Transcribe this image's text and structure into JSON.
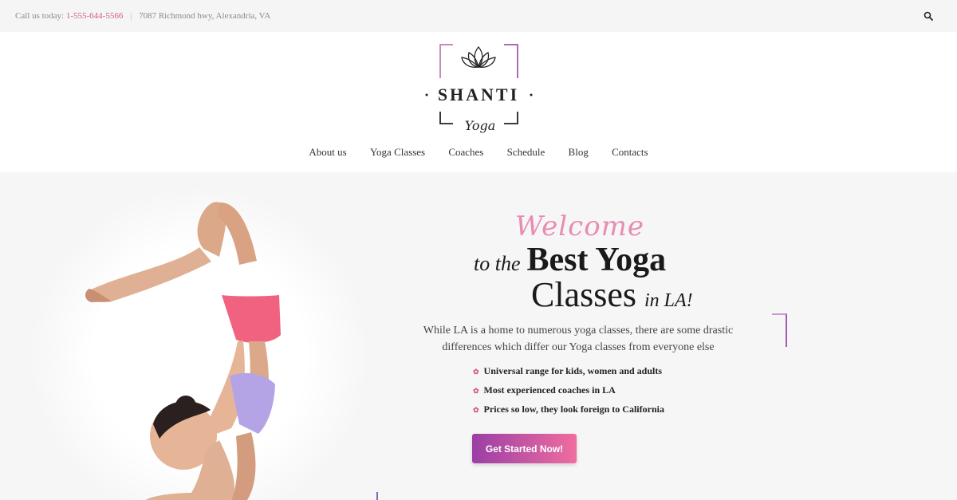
{
  "topbar": {
    "call_label": "Call us today:",
    "phone": "1-555-644-5566",
    "separator": "|",
    "address": "7087 Richmond hwy, Alexandria, VA",
    "search_icon": "search-icon"
  },
  "logo": {
    "brand": "SHANTI",
    "script": "Yoga",
    "icon": "lotus-icon"
  },
  "nav": {
    "items": [
      "About us",
      "Yoga Classes",
      "Coaches",
      "Schedule",
      "Blog",
      "Contacts"
    ]
  },
  "hero": {
    "welcome": "Welcome",
    "title_prefix": "to the",
    "title_main": "Best Yoga",
    "title_line2": "Classes",
    "title_suffix": "in LA!",
    "description": "While LA is a home to numerous yoga classes, there are some drastic differences which differ our Yoga classes from everyone else",
    "bullets": [
      "Universal range for kids, women and adults",
      "Most experienced coaches in LA",
      "Prices so low, they look foreign to California"
    ],
    "cta": "Get Started Now!"
  },
  "colors": {
    "accent": "#d45a8f",
    "welcome": "#e88cb4",
    "cta_start": "#9a3fa6",
    "cta_end": "#f06d9f"
  }
}
